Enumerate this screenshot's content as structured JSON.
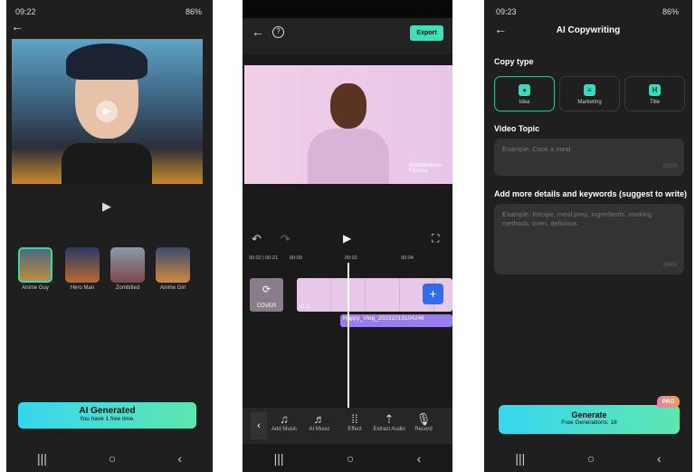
{
  "screen1": {
    "time": "09:22",
    "battery": "86%",
    "styles": [
      {
        "label": "Anime Guy",
        "selected": true
      },
      {
        "label": "Hero Man"
      },
      {
        "label": "Zombified"
      },
      {
        "label": "Anime Girl"
      }
    ],
    "button_title": "AI Generated",
    "button_sub": "You have 1 free time."
  },
  "screen2": {
    "export_label": "Export",
    "time_display": "00:02 | 00:21",
    "ticks": [
      "00:00",
      "00:02",
      "00:04"
    ],
    "cover_label": "COVER",
    "speed_label": "x1.0",
    "clip_name": "Happy_Vlog_20231019104246",
    "watermark": "Wondershare Filmora",
    "tools": [
      {
        "label": "Add Music",
        "icon": "music-add-icon"
      },
      {
        "label": "AI Music",
        "icon": "ai-music-icon"
      },
      {
        "label": "Effect",
        "icon": "effect-icon"
      },
      {
        "label": "Extract Audio",
        "icon": "extract-audio-icon"
      },
      {
        "label": "Record",
        "icon": "microphone-icon"
      }
    ]
  },
  "screen3": {
    "time": "09:23",
    "battery": "86%",
    "title": "AI Copywriting",
    "copy_type_label": "Copy type",
    "copy_types": [
      {
        "label": "Idea",
        "selected": true
      },
      {
        "label": "Marketing"
      },
      {
        "label": "Title"
      }
    ],
    "topic_label": "Video Topic",
    "topic_placeholder": "Example: Cook a meal",
    "topic_count": "0/200",
    "details_label": "Add more details and keywords (suggest to write)",
    "details_placeholder": "Example: Recipe, meal prep, ingredients, cooking methods, oven, delicious",
    "details_count": "0/400",
    "generate_label": "Generate",
    "generate_sub": "Free Generations: 18",
    "pro_badge": "PRO"
  },
  "colors": {
    "accent_gradient_start": "#36d6f0",
    "accent_gradient_end": "#5ee6b0",
    "purple": "#9b7cf0",
    "blue": "#2f6cf0"
  }
}
